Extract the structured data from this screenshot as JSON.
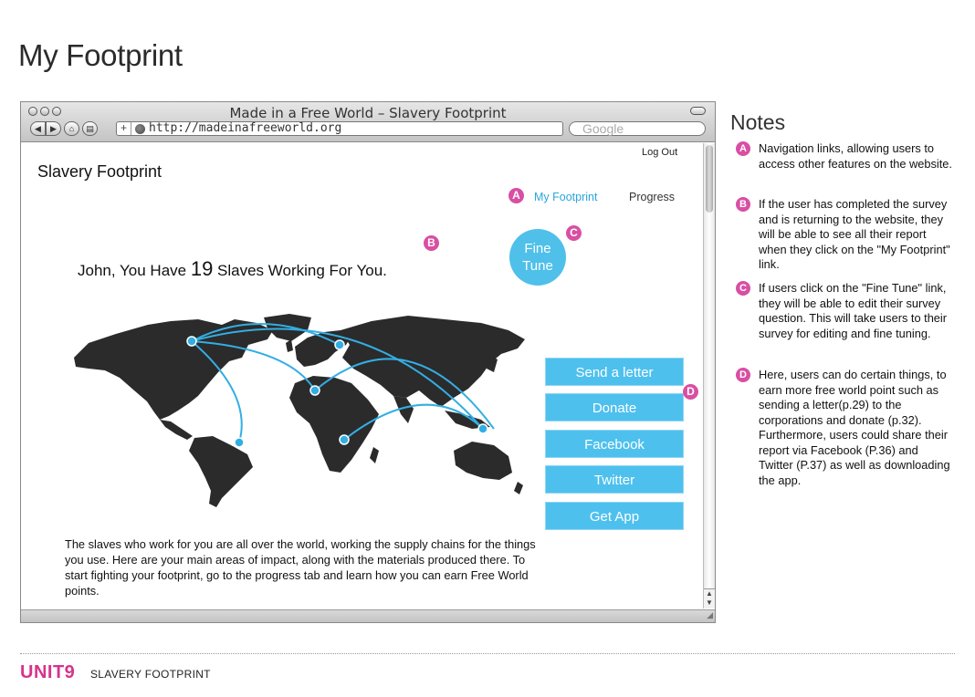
{
  "page": {
    "title": "My Footprint",
    "accent_color": "#d84fa4",
    "button_color": "#4ec0ee"
  },
  "browser": {
    "window_title": "Made in a Free World – Slavery Footprint",
    "url": "http://madeinafreeworld.org",
    "search_placeholder": "Google",
    "icons": [
      "back-icon",
      "forward-icon",
      "home-icon",
      "print-icon",
      "add-tab-icon",
      "globe-icon"
    ]
  },
  "site": {
    "logout_label": "Log Out",
    "title": "Slavery Footprint",
    "nav": {
      "marker": "A",
      "my_footprint": "My Footprint",
      "progress": "Progress"
    },
    "markers": {
      "b": "B",
      "c": "C",
      "d": "D"
    },
    "fine_tune": {
      "line1": "Fine",
      "line2": "Tune"
    },
    "headline": {
      "before": "John, You Have ",
      "count": "19",
      "after": " Slaves Working For You."
    },
    "actions": [
      {
        "label": "Send a letter"
      },
      {
        "label": "Donate"
      },
      {
        "label": "Facebook"
      },
      {
        "label": "Twitter"
      },
      {
        "label": "Get App"
      }
    ],
    "body_text": "The slaves who work for you are all over the world, working the supply chains for the things you use. Here are your main areas of impact, along with the materials produced there. To start fighting your footprint, go to the progress tab and learn how you can earn Free World points."
  },
  "notes": {
    "title": "Notes",
    "items": [
      {
        "marker": "A",
        "text": "Navigation links, allowing users to access other features on the website."
      },
      {
        "marker": "B",
        "text": "If the user has completed the survey and is returning to the website, they will be able to see all their report when they click on the \"My Footprint\" link."
      },
      {
        "marker": "C",
        "text": "If users click on the \"Fine Tune\" link, they will be able to edit their survey question. This will take users to their survey for editing and fine tuning."
      },
      {
        "marker": "D",
        "text": "Here, users can do certain things, to earn more free world point such as sending a letter(p.29) to the corporations and donate (p.32). Furthermore, users could share their report via Facebook (P.36) and Twitter (P.37) as well as downloading the app."
      }
    ]
  },
  "footer": {
    "logo": "UNIT9",
    "label": "SLAVERY FOOTPRINT"
  }
}
